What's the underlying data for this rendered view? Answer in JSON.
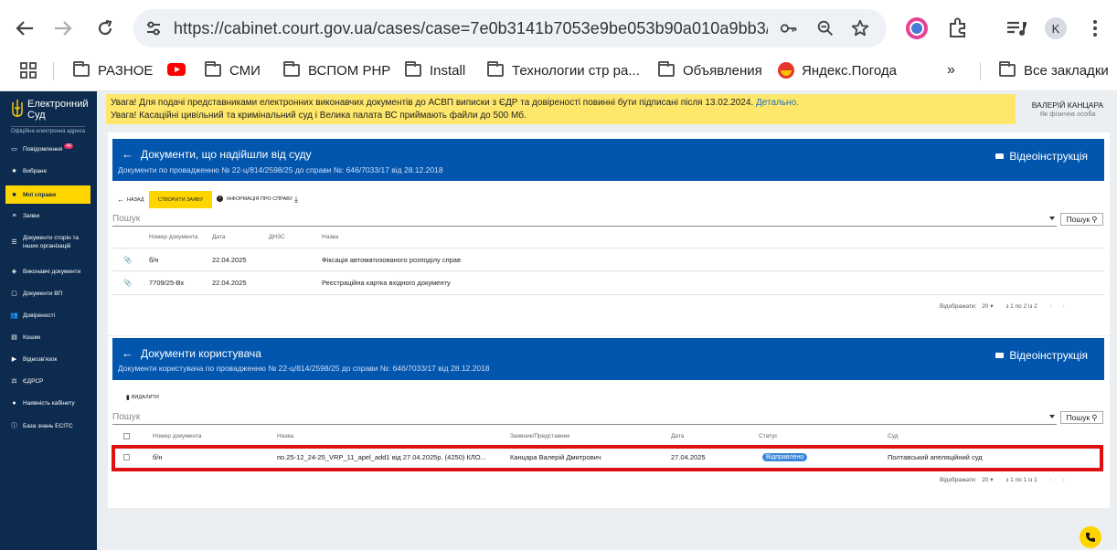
{
  "browser": {
    "url": "https://cabinet.court.gov.ua/cases/case=7e0b3141b7053e9be053b90a010a9bb3/pro...",
    "profile_initial": "K",
    "bookmarks": [
      "РАЗНОЕ",
      "СМИ",
      "ВСПОМ РНР",
      "Install",
      "Технологии стр ра...",
      "Объявления",
      "Яндекс.Погода",
      "Все закладки"
    ]
  },
  "sidebar": {
    "logo_title_line1": "Електронний",
    "logo_title_line2": "Суд",
    "logo_subtitle": "Офіційна електронна адреса",
    "items": [
      {
        "label": "Повідомлення",
        "badge": "46"
      },
      {
        "label": "Вибране"
      },
      {
        "label": "Мої справи"
      },
      {
        "label": "Заяви"
      },
      {
        "label": "Документи сторін та інших організацій"
      },
      {
        "label": "Виконавчі документи"
      },
      {
        "label": "Документи ВП"
      },
      {
        "label": "Довіреності"
      },
      {
        "label": "Кошик"
      },
      {
        "label": "Відеозв'язок"
      },
      {
        "label": "ЄДРСР"
      },
      {
        "label": "Наявність кабінету"
      },
      {
        "label": "База знань ЕСІТС"
      }
    ]
  },
  "notice": {
    "line1": "Увага! Для подачі представниками електронних виконавчих документів до АСВП виписки з ЄДР та довіреності повинні бути підписані після 13.02.2024.",
    "link": "Детально.",
    "line2": "Увага! Касаційні цивільний та кримінальний суд і Велика палата ВС приймають файли до 500 Мб."
  },
  "user": {
    "name": "ВАЛЕРІЙ КАНЦАРА",
    "role": "Як фізична особа"
  },
  "court_docs": {
    "title": "Документи, що надійшли від суду",
    "subtitle": "Документи по провадженню № 22-ц/814/2598/25 до справи №: 646/7033/17 від 28.12.2018",
    "video_label": "Відеоінструкція",
    "back_label": "НАЗАД",
    "create_label": "СТВОРИТИ ЗАЯВУ",
    "info_label": "ІНФОРМАЦІЯ ПРО СПРАВУ",
    "search_placeholder": "Пошук",
    "search_button": "Пошук",
    "columns": [
      "Номер документа",
      "Дата",
      "ДНЗС",
      "Назва"
    ],
    "rows": [
      {
        "number": "б/н",
        "date": "22.04.2025",
        "dnzs": "",
        "name": "Фіксація автоматизованого розподілу справ"
      },
      {
        "number": "7709/25-Вх",
        "date": "22.04.2025",
        "dnzs": "",
        "name": "Реєстраційна картка вхідного документу"
      }
    ],
    "pager_label": "Відображати:",
    "pager_size": "20",
    "pager_range": "з 1 по 2 із 2"
  },
  "user_docs": {
    "title": "Документи користувача",
    "subtitle": "Документи користувача по провадженню № 22-ц/814/2598/25 до справи №: 646/7033/17 від 28.12.2018",
    "video_label": "Відеоінструкція",
    "delete_label": "ВИДАЛИТИ",
    "search_placeholder": "Пошук",
    "search_button": "Пошук",
    "columns": [
      "Номер документа",
      "Назва",
      "Заявник/Представник",
      "Дата",
      "Статус",
      "Суд"
    ],
    "rows": [
      {
        "number": "б/н",
        "name": "по.25-12_24-25_VRP_11_apel_add1 від 27.04.2025р. (4250) КЛО...",
        "applicant": "Канцара Валерій Дмитрович",
        "date": "27.04.2025",
        "status": "Відправлено",
        "court": "Полтавський апеляційний суд"
      }
    ],
    "pager_label": "Відображати:",
    "pager_size": "20",
    "pager_range": "з 1 по 1 із 1"
  }
}
